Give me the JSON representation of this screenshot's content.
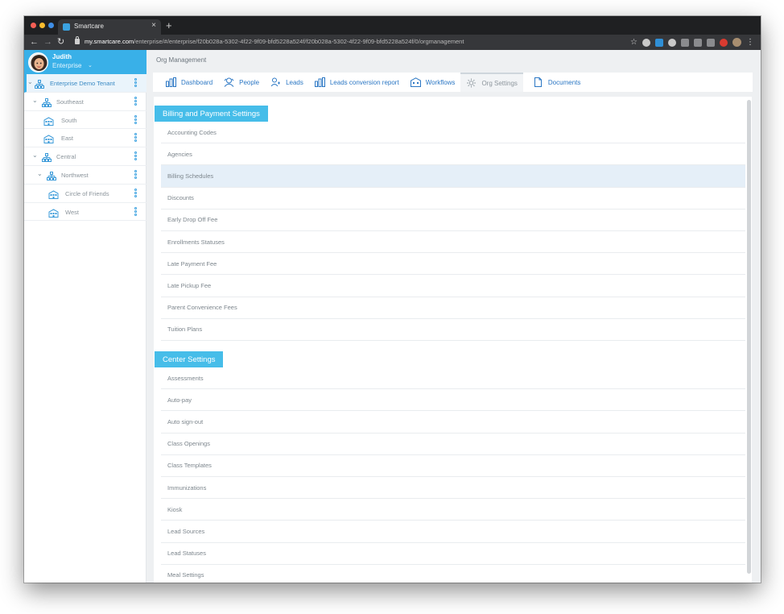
{
  "browser": {
    "tab_title": "Smartcare",
    "tab_close": "×",
    "new_tab": "+",
    "url_host": "my.smartcare.com",
    "url_path": "/enterprise/#/enterprise/f20b028a-5302-4f22-9f09-bfd5228a524f/f20b028a-5302-4f22-9f09-bfd5228a524f/0/orgmanagement"
  },
  "user": {
    "name": "Judith",
    "role": "Enterprise"
  },
  "tree": [
    {
      "label": "Enterprise Demo Tenant",
      "icon": "org-icon",
      "toggle": "⌄",
      "active": true
    },
    {
      "label": "Southeast",
      "icon": "org-icon",
      "toggle": "⌄"
    },
    {
      "label": "South",
      "icon": "building-icon"
    },
    {
      "label": "East",
      "icon": "building-icon"
    },
    {
      "label": "Central",
      "icon": "org-icon",
      "toggle": "⌄"
    },
    {
      "label": "Northwest",
      "icon": "org-icon",
      "toggle": "⌄"
    },
    {
      "label": "Circle of Friends",
      "icon": "building-icon"
    },
    {
      "label": "West",
      "icon": "building-icon"
    }
  ],
  "main": {
    "page_title": "Org Management",
    "tabs": [
      {
        "label": "Dashboard",
        "icon": "dashboard-icon"
      },
      {
        "label": "People",
        "icon": "people-icon"
      },
      {
        "label": "Leads",
        "icon": "leads-icon"
      },
      {
        "label": "Leads conversion report",
        "icon": "report-icon"
      },
      {
        "label": "Workflows",
        "icon": "workflows-icon"
      },
      {
        "label": "Org Settings",
        "icon": "gear-icon",
        "active": true
      },
      {
        "label": "Documents",
        "icon": "document-icon"
      }
    ],
    "billing": {
      "title": "Billing and Payment Settings",
      "items": [
        "Accounting Codes",
        "Agencies",
        "Billing Schedules",
        "Discounts",
        "Early Drop Off Fee",
        "Enrollments Statuses",
        "Late Payment Fee",
        "Late Pickup Fee",
        "Parent Convenience Fees",
        "Tuition Plans"
      ]
    },
    "center": {
      "title": "Center Settings",
      "items": [
        "Assessments",
        "Auto-pay",
        "Auto sign-out",
        "Class Openings",
        "Class Templates",
        "Immunizations",
        "Kiosk",
        "Lead Sources",
        "Lead Statuses",
        "Meal Settings"
      ]
    }
  },
  "colors": {
    "accent": "#39b0e8",
    "section_header": "#46bde9",
    "link": "#2b77c4",
    "highlight_row": "#e5eff8"
  }
}
